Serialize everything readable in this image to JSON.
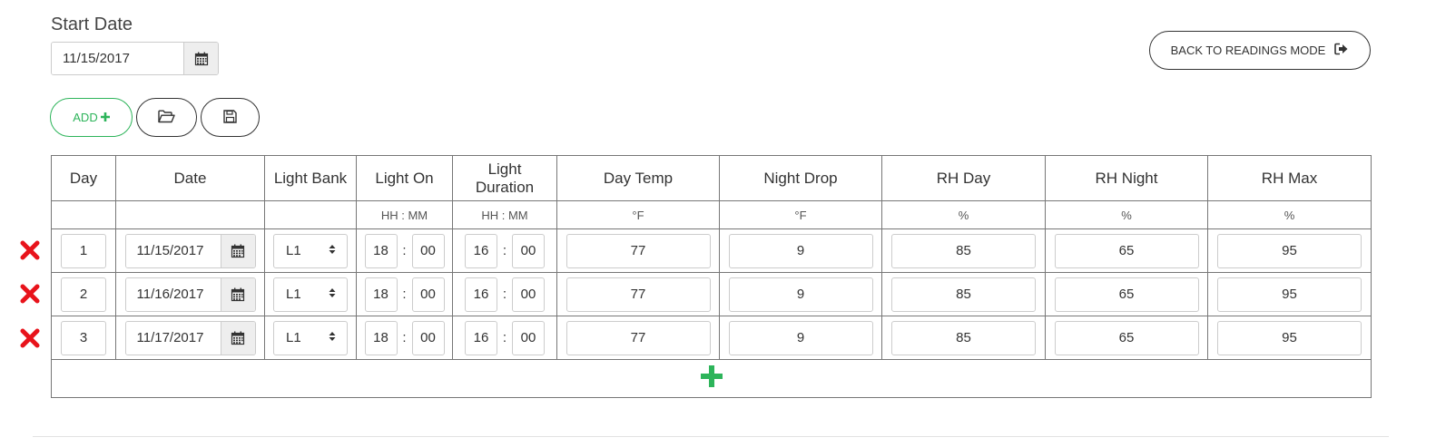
{
  "start_date": {
    "label": "Start Date",
    "value": "11/15/2017",
    "icon": "calendar-icon"
  },
  "back_button": {
    "label": "BACK TO READINGS MODE",
    "icon": "sign-out-icon"
  },
  "toolbar": {
    "add_label": "ADD",
    "add_icon": "plus-icon",
    "open_icon": "folder-open-icon",
    "save_icon": "floppy-disk-icon"
  },
  "table": {
    "columns": [
      {
        "header": "Day",
        "unit": ""
      },
      {
        "header": "Date",
        "unit": ""
      },
      {
        "header": "Light Bank",
        "unit": ""
      },
      {
        "header": "Light On",
        "unit": "HH : MM"
      },
      {
        "header": "Light Duration",
        "unit": "HH : MM"
      },
      {
        "header": "Day Temp",
        "unit": "°F"
      },
      {
        "header": "Night Drop",
        "unit": "°F"
      },
      {
        "header": "RH Day",
        "unit": "%"
      },
      {
        "header": "RH Night",
        "unit": "%"
      },
      {
        "header": "RH Max",
        "unit": "%"
      }
    ],
    "rows": [
      {
        "day": "1",
        "date": "11/15/2017",
        "light_bank": "L1",
        "light_on_hh": "18",
        "light_on_mm": "00",
        "duration_hh": "16",
        "duration_mm": "00",
        "day_temp": "77",
        "night_drop": "9",
        "rh_day": "85",
        "rh_night": "65",
        "rh_max": "95"
      },
      {
        "day": "2",
        "date": "11/16/2017",
        "light_bank": "L1",
        "light_on_hh": "18",
        "light_on_mm": "00",
        "duration_hh": "16",
        "duration_mm": "00",
        "day_temp": "77",
        "night_drop": "9",
        "rh_day": "85",
        "rh_night": "65",
        "rh_max": "95"
      },
      {
        "day": "3",
        "date": "11/17/2017",
        "light_bank": "L1",
        "light_on_hh": "18",
        "light_on_mm": "00",
        "duration_hh": "16",
        "duration_mm": "00",
        "day_temp": "77",
        "night_drop": "9",
        "rh_day": "85",
        "rh_night": "65",
        "rh_max": "95"
      }
    ],
    "time_separator": ":",
    "row_delete_icon": "close-icon",
    "add_row_icon": "plus-icon"
  },
  "colors": {
    "accent_green": "#2db45a",
    "delete_red": "#e8131b",
    "border": "#777777"
  }
}
